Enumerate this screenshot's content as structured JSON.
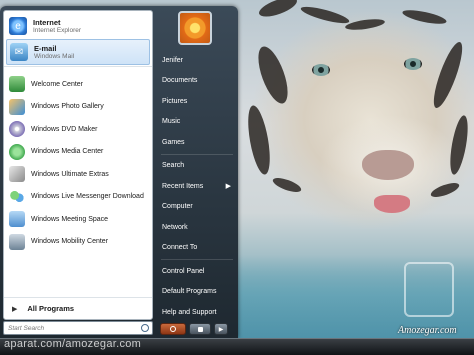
{
  "pinned": [
    {
      "label": "Internet",
      "sublabel": "Internet Explorer",
      "icon": "internet-explorer-icon"
    },
    {
      "label": "E-mail",
      "sublabel": "Windows Mail",
      "icon": "windows-mail-icon"
    }
  ],
  "recent": [
    {
      "label": "Welcome Center",
      "icon": "welcome-center-icon"
    },
    {
      "label": "Windows Photo Gallery",
      "icon": "photo-gallery-icon"
    },
    {
      "label": "Windows DVD Maker",
      "icon": "dvd-maker-icon"
    },
    {
      "label": "Windows Media Center",
      "icon": "media-center-icon"
    },
    {
      "label": "Windows Ultimate Extras",
      "icon": "ultimate-extras-icon"
    },
    {
      "label": "Windows Live Messenger Download",
      "icon": "messenger-icon"
    },
    {
      "label": "Windows Meeting Space",
      "icon": "meeting-space-icon"
    },
    {
      "label": "Windows Mobility Center",
      "icon": "mobility-center-icon"
    }
  ],
  "all_programs": {
    "label": "All Programs",
    "arrow": "▶"
  },
  "search": {
    "placeholder": "Start Search"
  },
  "right_pane": {
    "user": "Jenifer",
    "group1": [
      "Documents",
      "Pictures",
      "Music",
      "Games"
    ],
    "group2": [
      {
        "label": "Search"
      },
      {
        "label": "Recent Items",
        "chevron": "▶"
      },
      {
        "label": "Computer"
      },
      {
        "label": "Network"
      },
      {
        "label": "Connect To"
      }
    ],
    "group3": [
      "Control Panel",
      "Default Programs",
      "Help and Support"
    ]
  },
  "power": {
    "arrow": "▶"
  },
  "watermarks": {
    "corner": "Amozegar.com",
    "bottom": "aparat.com/amozegar.com"
  },
  "colors": {
    "menu_dark": "#1e2830",
    "menu_left": "#ffffff",
    "hover": "#cfe3f7"
  }
}
